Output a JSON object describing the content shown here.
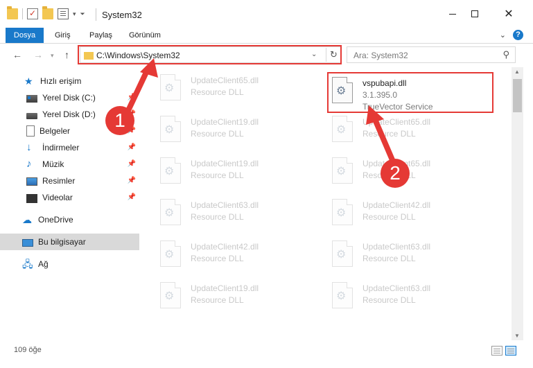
{
  "window": {
    "title": "System32"
  },
  "ribbon": {
    "tabs": [
      "Dosya",
      "Giriş",
      "Paylaş",
      "Görünüm"
    ]
  },
  "address": {
    "path": "C:\\Windows\\System32"
  },
  "search": {
    "placeholder": "Ara: System32"
  },
  "sidebar": {
    "items": [
      {
        "label": "Hızlı erişim",
        "icon": "star-icon"
      },
      {
        "label": "Yerel Disk (C:)",
        "icon": "drive-c-icon"
      },
      {
        "label": "Yerel Disk (D:)",
        "icon": "drive-d-icon"
      },
      {
        "label": "Belgeler",
        "icon": "documents-icon"
      },
      {
        "label": "İndirmeler",
        "icon": "downloads-icon"
      },
      {
        "label": "Müzik",
        "icon": "music-icon"
      },
      {
        "label": "Resimler",
        "icon": "pictures-icon"
      },
      {
        "label": "Videolar",
        "icon": "videos-icon"
      },
      {
        "label": "OneDrive",
        "icon": "onedrive-icon"
      },
      {
        "label": "Bu bilgisayar",
        "icon": "this-pc-icon"
      },
      {
        "label": "Ağ",
        "icon": "network-icon"
      }
    ]
  },
  "files": {
    "left": [
      {
        "name": "UpdateClient65.dll",
        "type": "Resource DLL"
      },
      {
        "name": "UpdateClient19.dll",
        "type": "Resource DLL"
      },
      {
        "name": "UpdateClient19.dll",
        "type": "Resource DLL"
      },
      {
        "name": "UpdateClient63.dll",
        "type": "Resource DLL"
      },
      {
        "name": "UpdateClient42.dll",
        "type": "Resource DLL"
      },
      {
        "name": "UpdateClient19.dll",
        "type": "Resource DLL"
      }
    ],
    "highlighted": {
      "name": "vspubapi.dll",
      "version": "3.1.395.0",
      "description": "TrueVector Service"
    },
    "right": [
      {
        "name": "UpdateClient65.dll",
        "type": "Resource DLL"
      },
      {
        "name": "UpdateClient65.dll",
        "type": "Resource DLL"
      },
      {
        "name": "UpdateClient42.dll",
        "type": "Resource DLL"
      },
      {
        "name": "UpdateClient63.dll",
        "type": "Resource DLL"
      },
      {
        "name": "UpdateClient63.dll",
        "type": "Resource DLL"
      }
    ]
  },
  "status": {
    "count": "109 öğe"
  },
  "callouts": [
    "1",
    "2"
  ],
  "colors": {
    "accent": "#1979ca",
    "highlight": "#e53935"
  }
}
